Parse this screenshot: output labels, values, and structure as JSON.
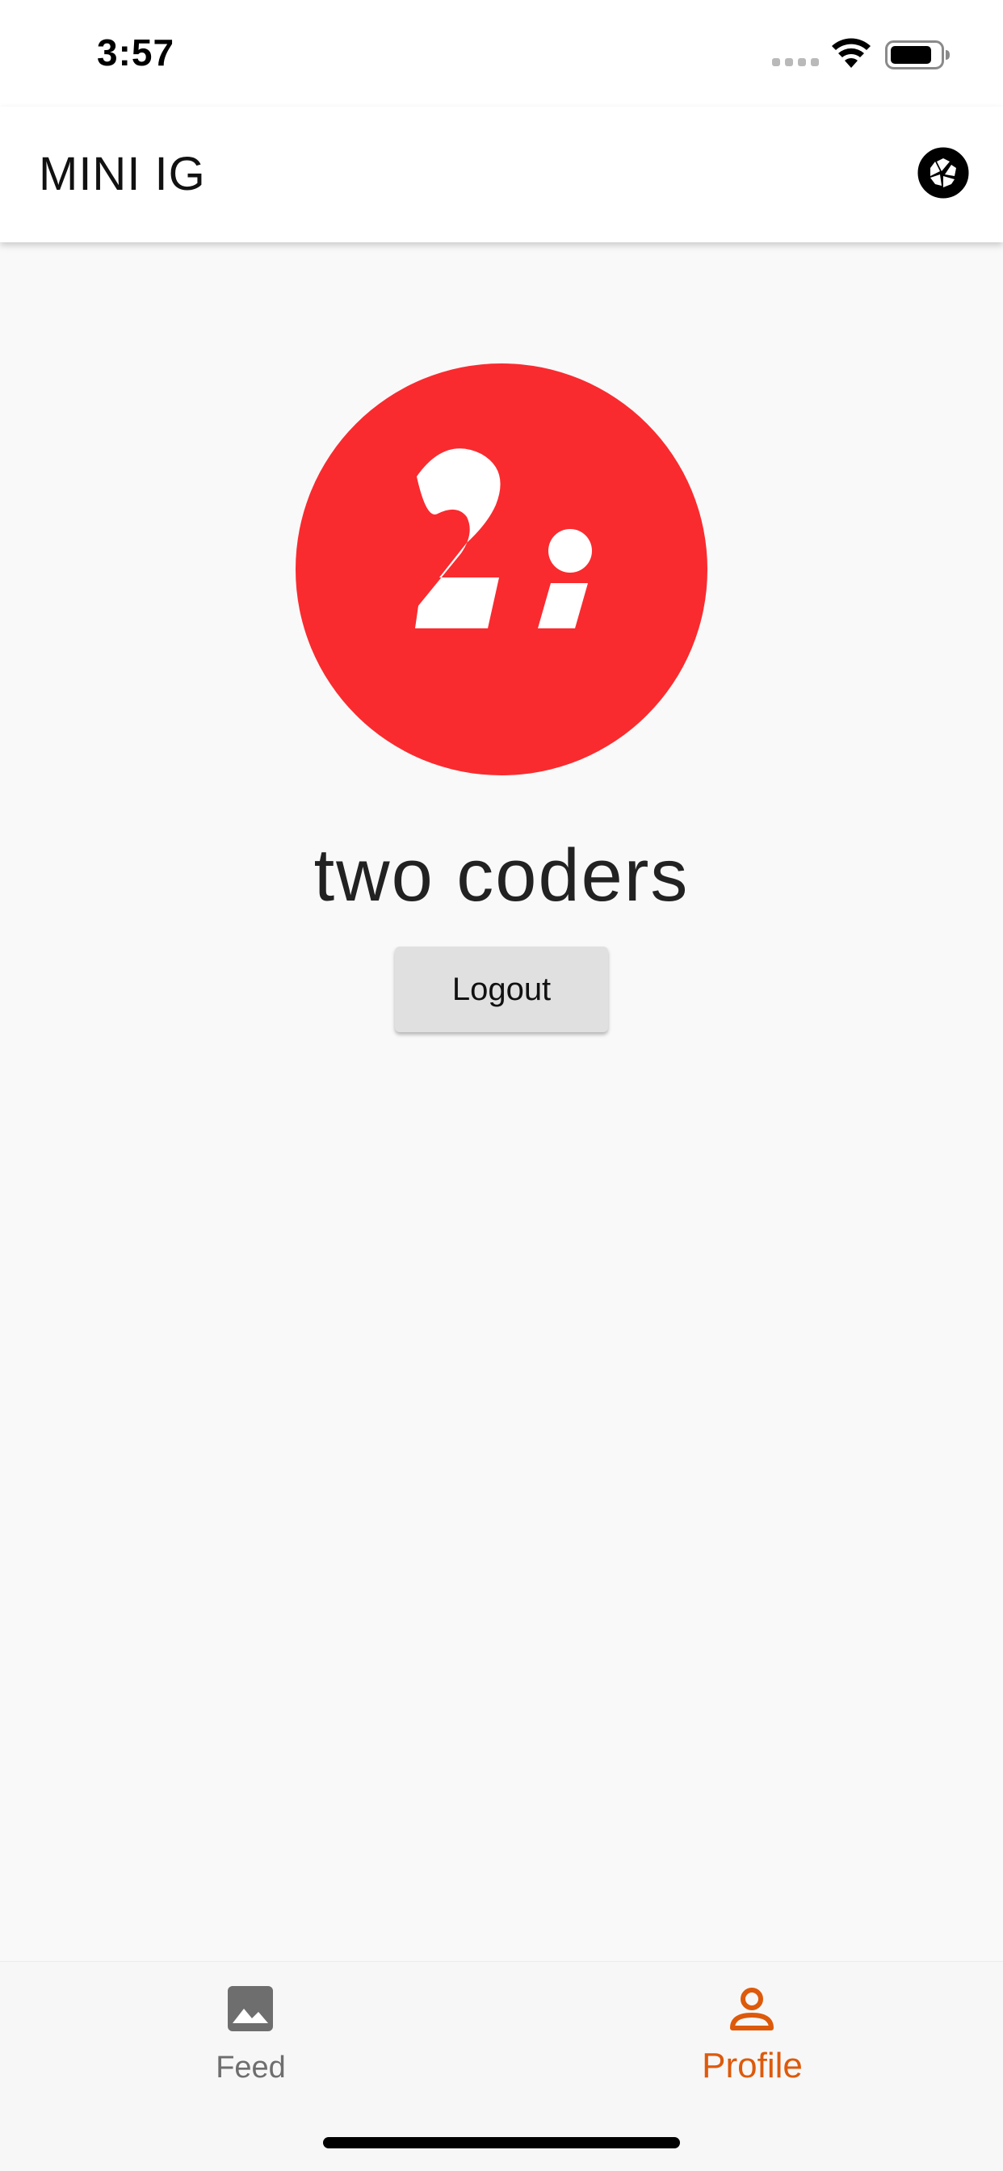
{
  "status_bar": {
    "time": "3:57"
  },
  "app_bar": {
    "title": "MINI IG",
    "camera_icon": "camera-shutter-icon"
  },
  "profile": {
    "avatar_text": "2;",
    "avatar_color": "#f92b2f",
    "name": "two coders",
    "logout_label": "Logout"
  },
  "bottom_nav": {
    "items": [
      {
        "label": "Feed",
        "icon": "image-icon",
        "active": false,
        "color": "#6e6e6e"
      },
      {
        "label": "Profile",
        "icon": "person-icon",
        "active": true,
        "color": "#dd5a0b"
      }
    ]
  }
}
